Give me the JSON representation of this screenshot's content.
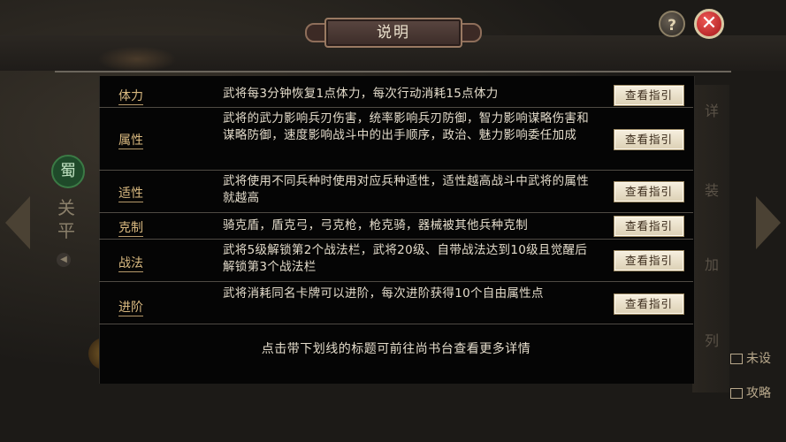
{
  "dialog": {
    "title": "说明",
    "footer_hint": "点击带下划线的标题可前往尚书台查看更多详情",
    "guide_button_label": "查看指引",
    "rows": [
      {
        "label": "体力",
        "description": "武将每3分钟恢复1点体力，每次行动消耗15点体力"
      },
      {
        "label": "属性",
        "description": "武将的武力影响兵刃伤害，统率影响兵刃防御，智力影响谋略伤害和谋略防御，速度影响战斗中的出手顺序，政治、魅力影响委任加成"
      },
      {
        "label": "适性",
        "description": "武将使用不同兵种时使用对应兵种适性，适性越高战斗中武将的属性就越高"
      },
      {
        "label": "克制",
        "description": "骑克盾，盾克弓，弓克枪，枪克骑，器械被其他兵种克制"
      },
      {
        "label": "战法",
        "description": "武将5级解锁第2个战法栏，武将20级、自带战法达到10级且觉醒后解锁第3个战法栏"
      },
      {
        "label": "进阶",
        "description": "武将消耗同名卡牌可以进阶，每次进阶获得10个自由属性点"
      }
    ]
  },
  "top_buttons": {
    "help": "?",
    "close": "✕"
  },
  "background": {
    "hero_name": "关平",
    "side_tabs": [
      "详",
      "装",
      "加",
      "列"
    ],
    "side_items": [
      "未设",
      "攻略"
    ]
  },
  "colors": {
    "label_gold": "#d9b980",
    "desc_text": "#e4dccb",
    "button_bg": "#f6efdf",
    "close_red": "#d33a36"
  }
}
